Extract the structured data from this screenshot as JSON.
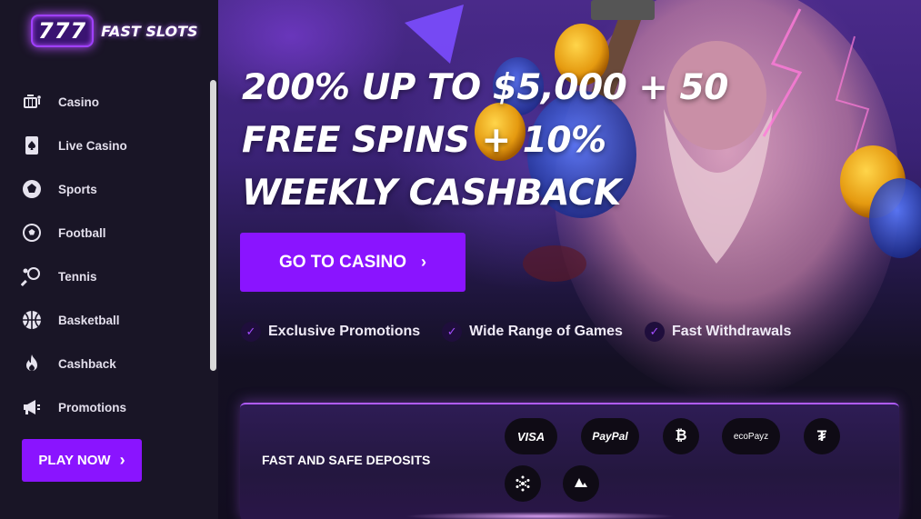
{
  "brand": {
    "logo_number": "777",
    "logo_text": "FAST SLOTS"
  },
  "sidebar": {
    "items": [
      {
        "label": "Casino",
        "icon": "casino-icon"
      },
      {
        "label": "Live Casino",
        "icon": "playing-card-icon"
      },
      {
        "label": "Sports",
        "icon": "sports-icon"
      },
      {
        "label": "Football",
        "icon": "football-icon"
      },
      {
        "label": "Tennis",
        "icon": "tennis-icon"
      },
      {
        "label": "Basketball",
        "icon": "basketball-icon"
      },
      {
        "label": "Cashback",
        "icon": "fire-icon"
      },
      {
        "label": "Promotions",
        "icon": "megaphone-icon"
      }
    ],
    "play_label": "PLAY NOW"
  },
  "hero": {
    "headline": "200% UP TO $5,000 + 50 FREE SPINS + 10% WEEKLY CASHBACK",
    "cta_label": "GO TO CASINO",
    "features": [
      "Exclusive Promotions",
      "Wide Range of Games",
      "Fast Withdrawals"
    ]
  },
  "deposits": {
    "title": "FAST AND SAFE DEPOSITS",
    "methods": [
      "VISA",
      "PayPal",
      "Bitcoin",
      "ecoPayz",
      "Tether",
      "Cardano",
      "Avalanche"
    ]
  },
  "colors": {
    "accent": "#8a14ff",
    "sidebar_bg": "#191526",
    "page_bg": "#120d1f"
  }
}
